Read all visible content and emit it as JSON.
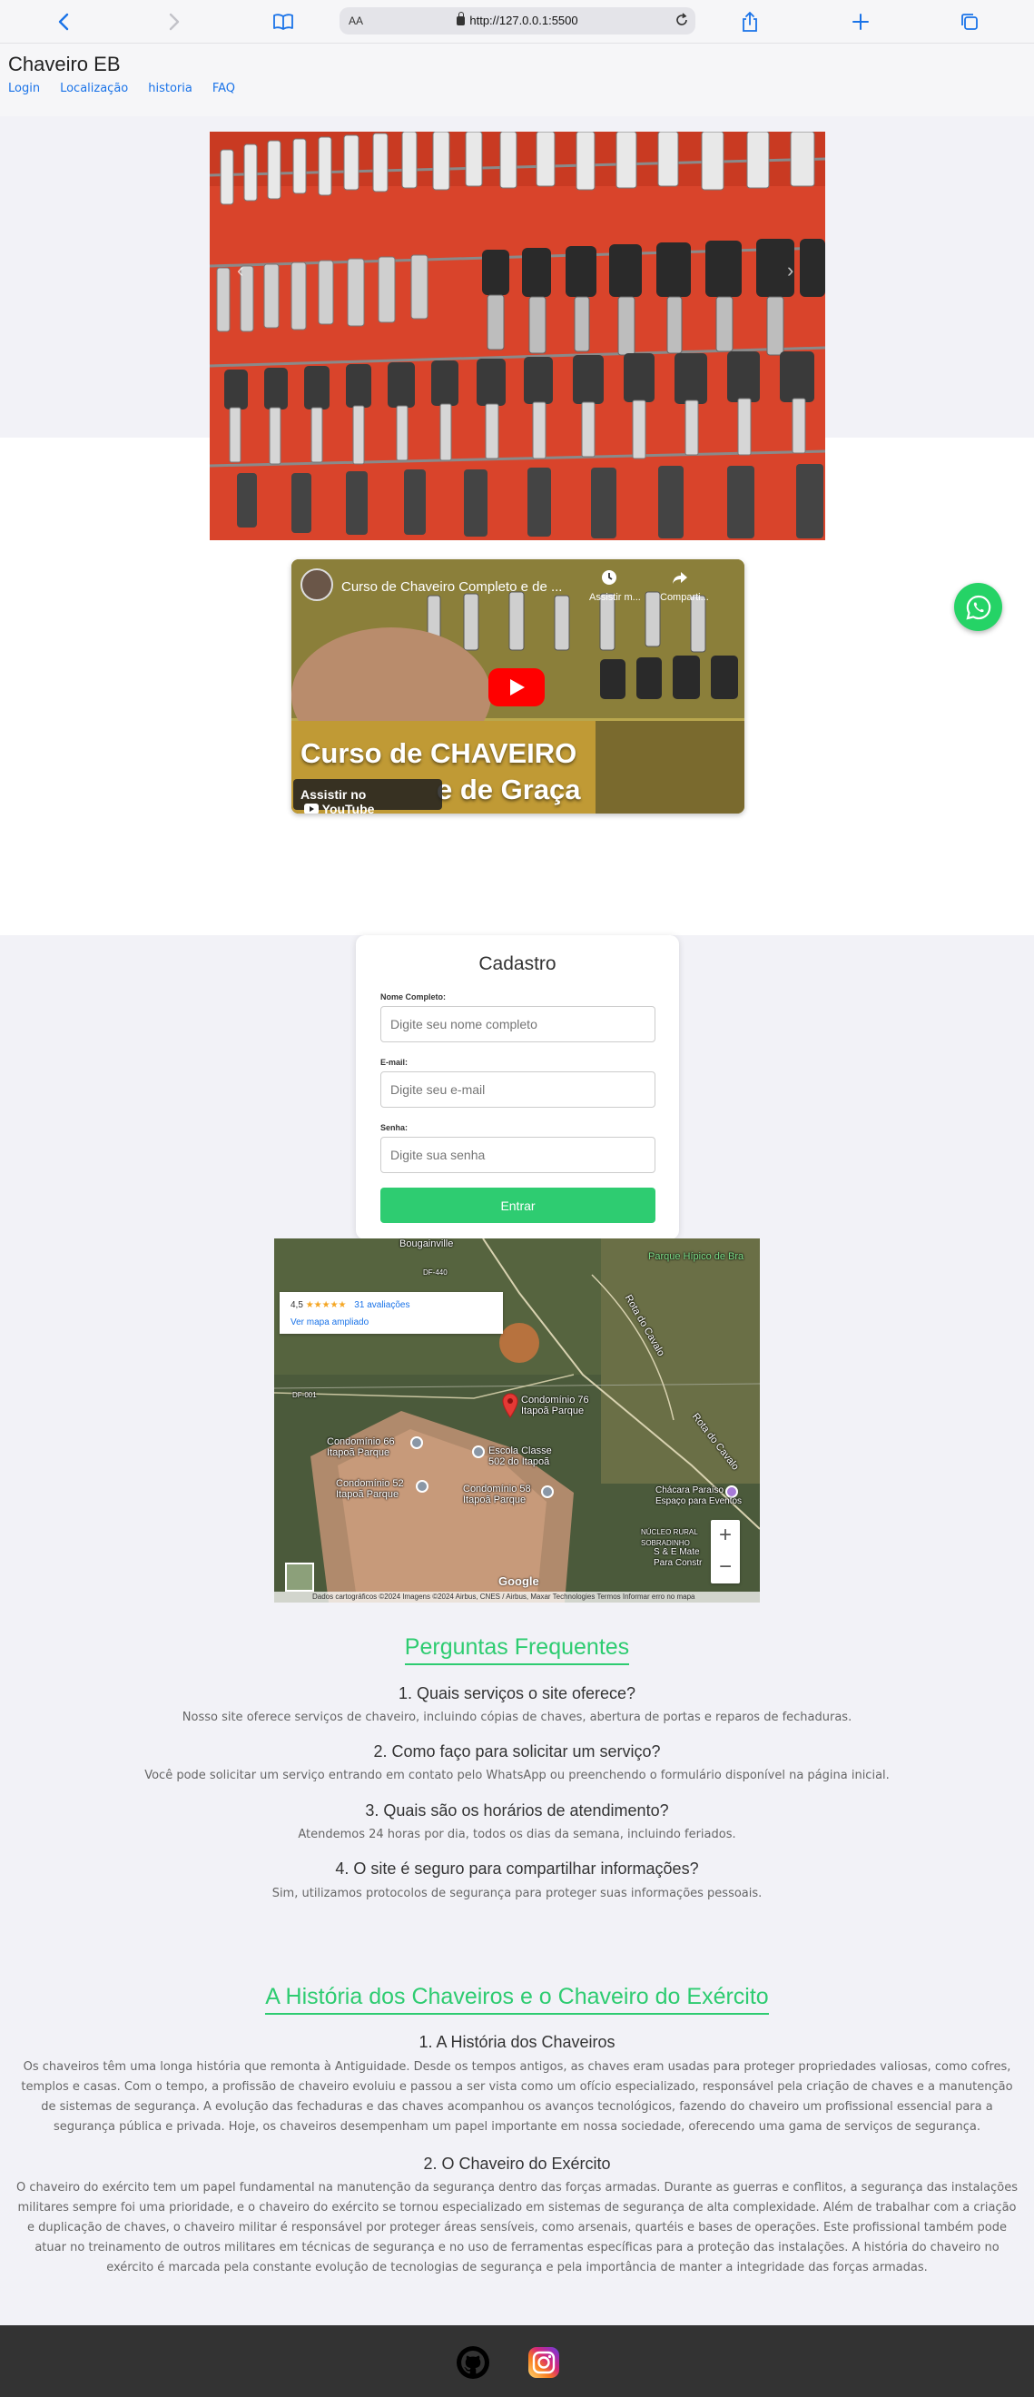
{
  "browser": {
    "url": "http://127.0.0.1:5500",
    "aa_label": "AA"
  },
  "site": {
    "brand": "Chaveiro EB",
    "nav": [
      "Login",
      "Localização",
      "historia",
      "FAQ"
    ]
  },
  "video": {
    "title": "Curso de Chaveiro Completo e de ...",
    "watch_later": "Assistir m...",
    "share": "Comparti...",
    "caption_line1": "Curso de CHAVEIRO",
    "caption_line2": "e de Graça",
    "watch_on": "Assistir no",
    "youtube": "YouTube"
  },
  "form": {
    "title": "Cadastro",
    "name_label": "Nome Completo:",
    "name_placeholder": "Digite seu nome completo",
    "email_label": "E-mail:",
    "email_placeholder": "Digite seu e-mail",
    "password_label": "Senha:",
    "password_placeholder": "Digite sua senha",
    "submit": "Entrar"
  },
  "map": {
    "rating": "4,5",
    "stars": "★★★★★",
    "reviews": "31 avaliações",
    "enlarge": "Ver mapa ampliado",
    "labels": {
      "bougainville": "Bougainville",
      "df440": "DF-440",
      "df001": "DF-001",
      "hipico": "Parque Hípico de Bra",
      "rota_cavalo": "Rota do Cavalo",
      "rota_cavalo2": "Rota do Cavalo",
      "condominio76": "Condomínio 76\nItapoã Parque",
      "condominio66": "Condomínio 66\nItapoã Parque",
      "escola": "Escola Classe\n502 do Itapoã",
      "condominio52": "Condomínio 52\nItapoã Parque",
      "condominio58": "Condomínio 58\nItapoã Parque",
      "chacara": "Chácara Paraíso\nEspaço para Eventos",
      "nucleo": "NÚCLEO RURAL\nSOBRADINHO",
      "se": "S & E Mate\nPara Constr"
    },
    "google": "Google",
    "attribution": "Dados cartográficos ©2024 Imagens ©2024 Airbus, CNES / Airbus, Maxar Technologies   Termos   Informar erro no mapa"
  },
  "faq": {
    "title": "Perguntas Frequentes",
    "items": [
      {
        "q": "1. Quais serviços o site oferece?",
        "a": "Nosso site oferece serviços de chaveiro, incluindo cópias de chaves, abertura de portas e reparos de fechaduras."
      },
      {
        "q": "2. Como faço para solicitar um serviço?",
        "a": "Você pode solicitar um serviço entrando em contato pelo WhatsApp ou preenchendo o formulário disponível na página inicial."
      },
      {
        "q": "3. Quais são os horários de atendimento?",
        "a": "Atendemos 24 horas por dia, todos os dias da semana, incluindo feriados."
      },
      {
        "q": "4. O site é seguro para compartilhar informações?",
        "a": "Sim, utilizamos protocolos de segurança para proteger suas informações pessoais."
      }
    ]
  },
  "history": {
    "title": "A História dos Chaveiros e o Chaveiro do Exército",
    "s1_title": "1. A História dos Chaveiros",
    "s1_text": "Os chaveiros têm uma longa história que remonta à Antiguidade. Desde os tempos antigos, as chaves eram usadas para proteger propriedades valiosas, como cofres, templos e casas. Com o tempo, a profissão de chaveiro evoluiu e passou a ser vista como um ofício especializado, responsável pela criação de chaves e a manutenção de sistemas de segurança. A evolução das fechaduras e das chaves acompanhou os avanços tecnológicos, fazendo do chaveiro um profissional essencial para a segurança pública e privada. Hoje, os chaveiros desempenham um papel importante em nossa sociedade, oferecendo uma gama de serviços de segurança.",
    "s2_title": "2. O Chaveiro do Exército",
    "s2_text": "O chaveiro do exército tem um papel fundamental na manutenção da segurança dentro das forças armadas. Durante as guerras e conflitos, a segurança das instalações militares sempre foi uma prioridade, e o chaveiro do exército se tornou especializado em sistemas de segurança de alta complexidade. Além de trabalhar com a criação e duplicação de chaves, o chaveiro militar é responsável por proteger áreas sensíveis, como arsenais, quartéis e bases de operações. Este profissional também pode atuar no treinamento de outros militares em técnicas de segurança e no uso de ferramentas específicas para a proteção das instalações. A história do chaveiro no exército é marcada pela constante evolução de tecnologias de segurança e pela importância de manter a integridade das forças armadas."
  },
  "colors": {
    "accent": "#2ecc71",
    "link": "#1a73e8",
    "whatsapp": "#25d366",
    "footer": "#333333"
  }
}
